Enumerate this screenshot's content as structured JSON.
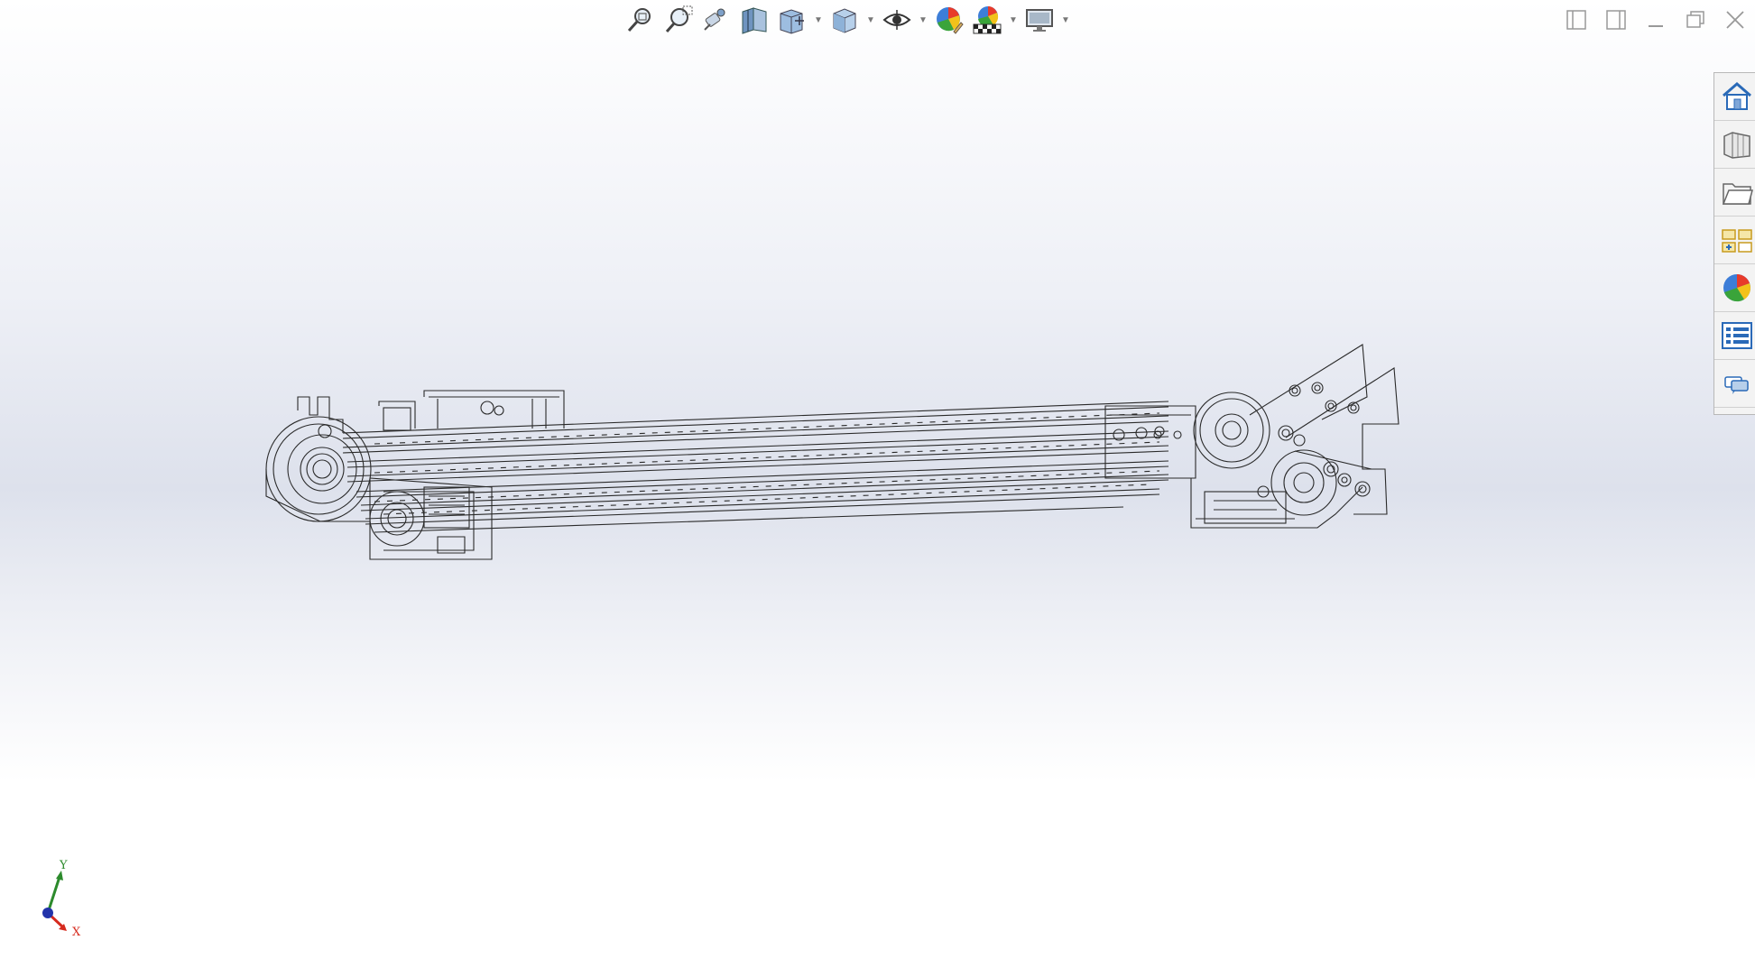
{
  "heads_up_toolbar": {
    "buttons": [
      {
        "id": "zoom-to-fit",
        "icon": "zoom-to-fit-icon"
      },
      {
        "id": "zoom-to-area",
        "icon": "zoom-to-area-icon"
      },
      {
        "id": "previous-view",
        "icon": "previous-view-icon"
      },
      {
        "id": "section-view",
        "icon": "section-view-icon"
      },
      {
        "id": "view-orientation",
        "icon": "view-orientation-icon"
      },
      {
        "id": "display-style",
        "icon": "display-style-icon"
      },
      {
        "id": "hide-show-items",
        "icon": "hide-show-items-icon"
      },
      {
        "id": "edit-appearance",
        "icon": "edit-appearance-icon"
      },
      {
        "id": "apply-scene",
        "icon": "apply-scene-icon"
      },
      {
        "id": "view-settings",
        "icon": "view-settings-icon"
      }
    ]
  },
  "window_controls": [
    "tile-left-icon",
    "tile-right-icon",
    "minimize-icon",
    "restore-icon",
    "close-icon"
  ],
  "task_pane": {
    "tabs": [
      "solidworks-resources-icon",
      "design-library-icon",
      "file-explorer-icon",
      "view-palette-icon",
      "appearances-scenes-icon",
      "custom-properties-icon",
      "forum-icon"
    ]
  },
  "triad": {
    "x_label": "X",
    "y_label": "Y"
  },
  "colors": {
    "x_axis": "#d62a1e",
    "y_axis": "#2c8a2c",
    "z_axis": "#2233aa",
    "wireframe": "#2a2a2a"
  }
}
